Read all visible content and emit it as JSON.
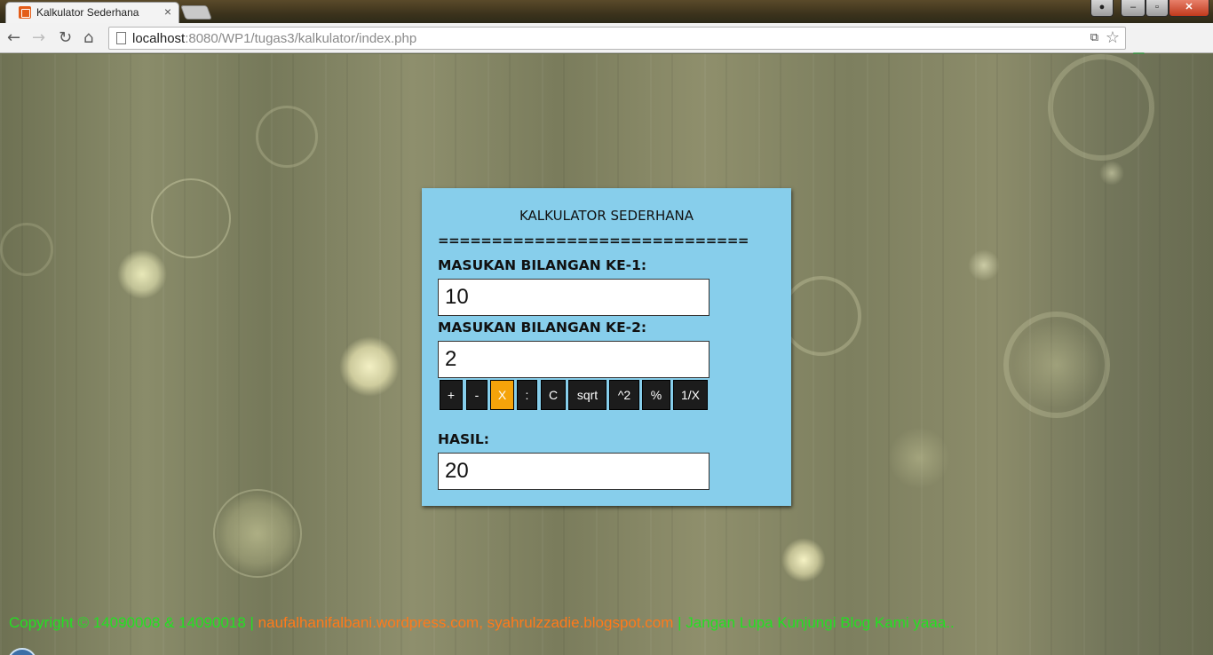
{
  "browser": {
    "tab_title": "Kalkulator Sederhana",
    "tab_close": "×",
    "url_host": "localhost",
    "url_path": ":8080/WP1/tugas3/kalkulator/index.php",
    "window_controls": {
      "minimize": "–",
      "maximize": "▫",
      "close": "✕"
    }
  },
  "calculator": {
    "title": "KALKULATOR SEDERHANA",
    "divider": "=============================",
    "label_input1": "MASUKAN BILANGAN KE-1:",
    "input1_value": "10",
    "label_input2": "MASUKAN BILANGAN KE-2:",
    "input2_value": "2",
    "operators": [
      "+",
      "-",
      "X",
      ":",
      "C",
      "sqrt",
      "^2",
      "%",
      "1/X"
    ],
    "active_operator": "X",
    "label_result": "HASIL:",
    "result_value": "20"
  },
  "footer": {
    "part1": "Copyright © 14090008 & 14090018 | ",
    "part2": "naufalhanifalbani.wordpress.com, syahrulzzadie.blogspot.com",
    "part3": " | Jangan Lupa Kunjungi Blog Kami yaaa.."
  },
  "colors": {
    "panel_bg": "#87ceeb",
    "button_bg": "#1c1c1c",
    "button_active": "#f5a30a",
    "footer_green": "#23e022",
    "footer_orange": "#ff7a1a"
  }
}
